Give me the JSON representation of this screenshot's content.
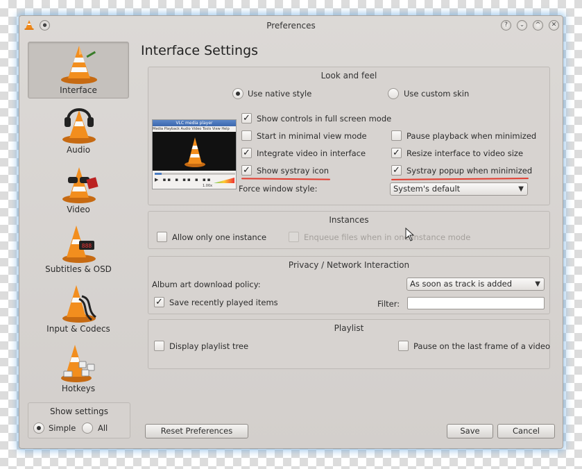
{
  "window": {
    "title": "Preferences"
  },
  "titlebar_buttons": [
    "?",
    "⌄",
    "^",
    "✕"
  ],
  "sidebar": {
    "items": [
      {
        "label": "Interface"
      },
      {
        "label": "Audio"
      },
      {
        "label": "Video"
      },
      {
        "label": "Subtitles & OSD"
      },
      {
        "label": "Input & Codecs"
      },
      {
        "label": "Hotkeys"
      }
    ],
    "show_settings": {
      "title": "Show settings",
      "simple": "Simple",
      "all": "All"
    }
  },
  "page_title": "Interface Settings",
  "look_and_feel": {
    "title": "Look and feel",
    "native_style": "Use native style",
    "custom_skin": "Use custom skin",
    "show_controls": "Show controls in full screen mode",
    "minimal_view": "Start in minimal view mode",
    "pause_minimized": "Pause playback when minimized",
    "integrate_video": "Integrate video in interface",
    "resize_interface": "Resize interface to video size",
    "systray_icon": "Show systray icon",
    "systray_popup": "Systray popup when minimized",
    "force_window_style": "Force window style:",
    "window_style_value": "System's default",
    "preview_title": "VLC media player",
    "preview_menu": [
      "Media",
      "Playback",
      "Audio",
      "Video",
      "Tools",
      "View",
      "Help"
    ],
    "preview_speed": "1.00x"
  },
  "instances": {
    "title": "Instances",
    "one_instance": "Allow only one instance",
    "enqueue": "Enqueue files when in one instance mode"
  },
  "privacy": {
    "title": "Privacy / Network Interaction",
    "album_art_label": "Album art download policy:",
    "album_art_value": "As soon as track is added",
    "save_recent": "Save recently played items",
    "filter_label": "Filter:",
    "filter_value": ""
  },
  "playlist": {
    "title": "Playlist",
    "playlist_tree": "Display playlist tree",
    "pause_last_frame": "Pause on the last frame of a video"
  },
  "footer": {
    "reset": "Reset Preferences",
    "save": "Save",
    "cancel": "Cancel"
  },
  "colors": {
    "accent_red": "#e23b2e",
    "cone_orange": "#f08a1c",
    "window_bg": "#d8d4d1"
  },
  "icons": [
    "vlc-cone-icon",
    "headphones-icon",
    "glasses-icon",
    "subtitle-display-icon",
    "cable-plug-icon",
    "keyboard-keys-icon"
  ]
}
